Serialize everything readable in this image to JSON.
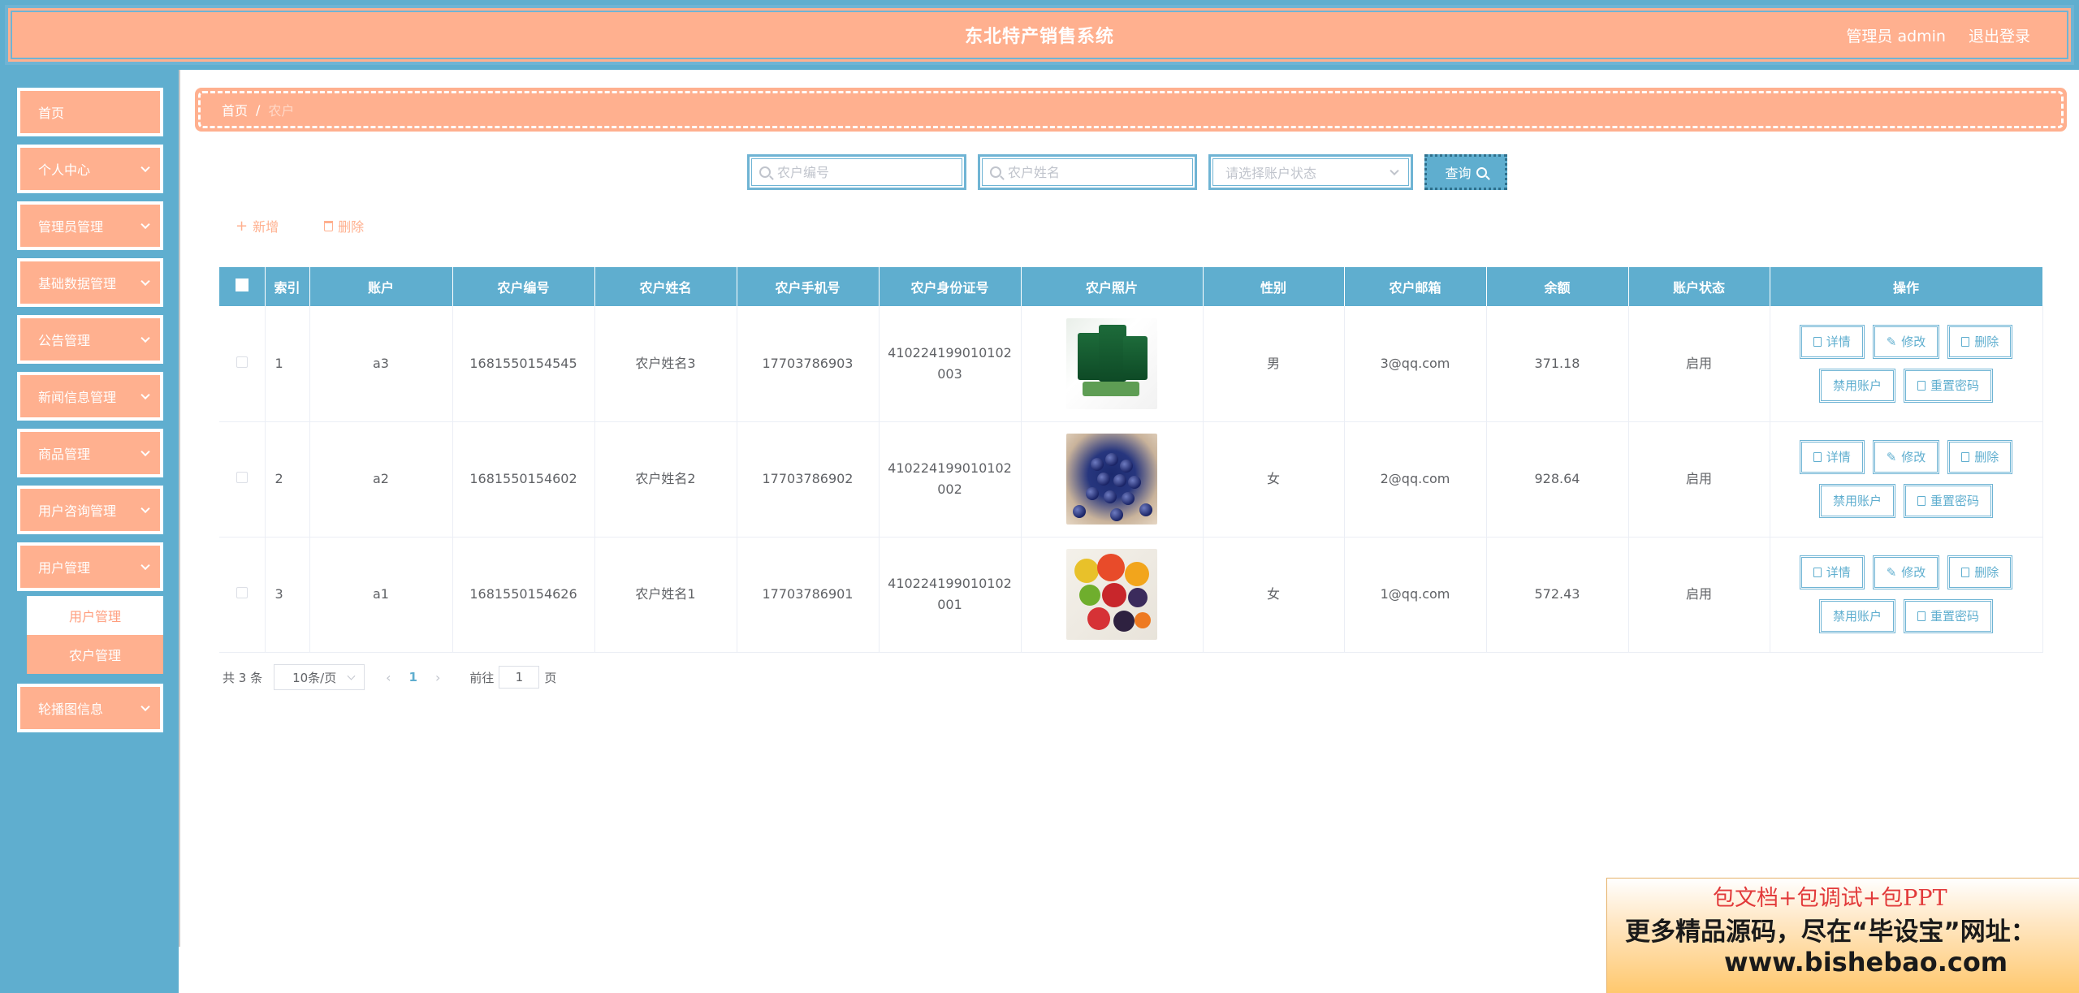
{
  "header": {
    "title": "东北特产销售系统",
    "admin_label": "管理员 admin",
    "logout_label": "退出登录"
  },
  "sidebar": {
    "items": [
      {
        "label": "首页",
        "has_arrow": false
      },
      {
        "label": "个人中心",
        "has_arrow": true
      },
      {
        "label": "管理员管理",
        "has_arrow": true
      },
      {
        "label": "基础数据管理",
        "has_arrow": true
      },
      {
        "label": "公告管理",
        "has_arrow": true
      },
      {
        "label": "新闻信息管理",
        "has_arrow": true
      },
      {
        "label": "商品管理",
        "has_arrow": true
      },
      {
        "label": "用户咨询管理",
        "has_arrow": true
      },
      {
        "label": "用户管理",
        "has_arrow": true
      },
      {
        "label": "轮播图信息",
        "has_arrow": true
      }
    ],
    "submenu": [
      {
        "label": "用户管理",
        "active": false
      },
      {
        "label": "农户管理",
        "active": true
      }
    ]
  },
  "breadcrumb": {
    "home": "首页",
    "separator": "/",
    "current": "农户"
  },
  "search": {
    "farmer_no_placeholder": "农户编号",
    "farmer_name_placeholder": "农户姓名",
    "status_placeholder": "请选择账户状态",
    "button_label": "查询"
  },
  "actions": {
    "add_label": "新增",
    "delete_label": "删除"
  },
  "table": {
    "columns": [
      "索引",
      "账户",
      "农户编号",
      "农户姓名",
      "农户手机号",
      "农户身份证号",
      "农户照片",
      "性别",
      "农户邮箱",
      "余额",
      "账户状态",
      "操作"
    ],
    "rows": [
      {
        "index": "1",
        "account": "a3",
        "farmer_no": "1681550154545",
        "name": "农户姓名3",
        "phone": "17703786903",
        "id_card": "410224199010102003",
        "photo": "green-packages",
        "gender": "男",
        "email": "3@qq.com",
        "balance": "371.18",
        "status": "启用"
      },
      {
        "index": "2",
        "account": "a2",
        "farmer_no": "1681550154602",
        "name": "农户姓名2",
        "phone": "17703786902",
        "id_card": "410224199010102002",
        "photo": "blueberries",
        "gender": "女",
        "email": "2@qq.com",
        "balance": "928.64",
        "status": "启用"
      },
      {
        "index": "3",
        "account": "a1",
        "farmer_no": "1681550154626",
        "name": "农户姓名1",
        "phone": "17703786901",
        "id_card": "410224199010102001",
        "photo": "mixed-fruit",
        "gender": "女",
        "email": "1@qq.com",
        "balance": "572.43",
        "status": "启用"
      }
    ],
    "op_labels": {
      "detail": "详情",
      "edit": "修改",
      "delete": "删除",
      "disable": "禁用账户",
      "reset": "重置密码"
    }
  },
  "pagination": {
    "total_text": "共 3 条",
    "page_size": "10条/页",
    "current_page": "1",
    "goto_prefix": "前往",
    "goto_value": "1",
    "goto_suffix": "页"
  },
  "promo": {
    "line1": "包文档+包调试+包PPT",
    "line2": "更多精品源码，尽在“毕设宝”网址：",
    "line3": "www.bishebao.com"
  },
  "colors": {
    "primary_blue": "#5faecf",
    "salmon": "#ffb08f"
  }
}
